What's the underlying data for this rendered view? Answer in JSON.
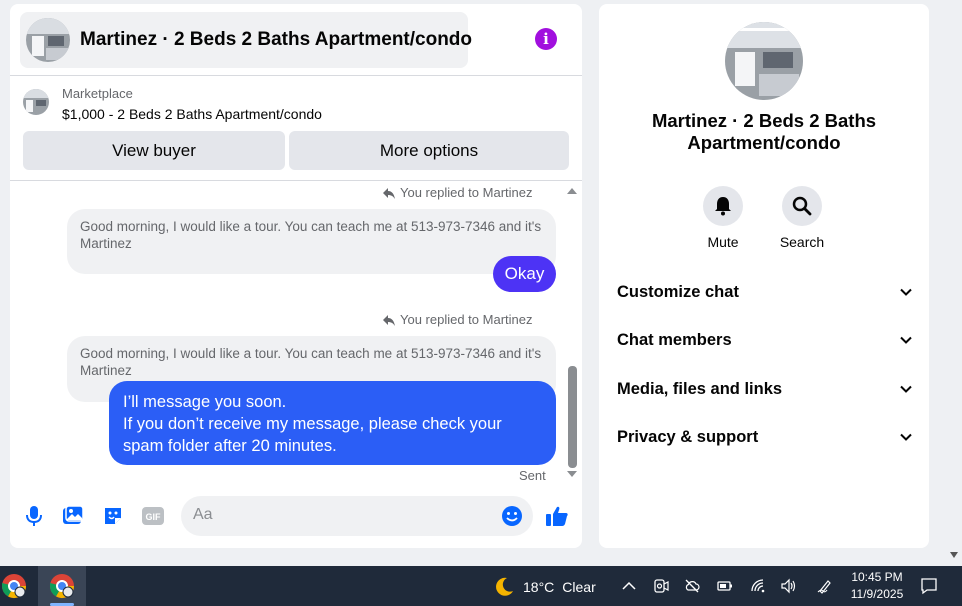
{
  "chat": {
    "title": "Martinez · 2 Beds 2 Baths Apartment/condo",
    "marketplace_label": "Marketplace",
    "listing": "$1,000 - 2 Beds 2 Baths Apartment/condo",
    "view_buyer": "View buyer",
    "more_options": "More options"
  },
  "messages": {
    "reply_note_1": "You replied to Martinez",
    "quoted_1": "Good morning, I would like a tour. You can teach me at 513-973-7346 and it's Martinez",
    "okay": "Okay",
    "reply_note_2": "You replied to Martinez",
    "quoted_2": "Good morning, I would like a tour. You can teach me at 513-973-7346 and it's Martinez",
    "outgoing_line_1": "I’ll message you soon.",
    "outgoing_line_2": "If you don’t receive my message, please check your spam folder after 20 minutes.",
    "status": "Sent"
  },
  "composer": {
    "placeholder": "Aa",
    "gif": "GIF"
  },
  "info": {
    "title": "Martinez · 2 Beds 2 Baths Apartment/condo",
    "mute": "Mute",
    "search": "Search",
    "sections": [
      "Customize chat",
      "Chat members",
      "Media, files and links",
      "Privacy & support"
    ]
  },
  "taskbar": {
    "temperature": "18°C",
    "condition": "Clear",
    "time": "10:45 PM",
    "date": "11/9/2025"
  },
  "colors": {
    "accent_purple": "#a10fde",
    "okay_bubble": "#4d33f5",
    "outgoing_bubble": "#2b5ef6",
    "composer_icons": "#0866ff"
  }
}
